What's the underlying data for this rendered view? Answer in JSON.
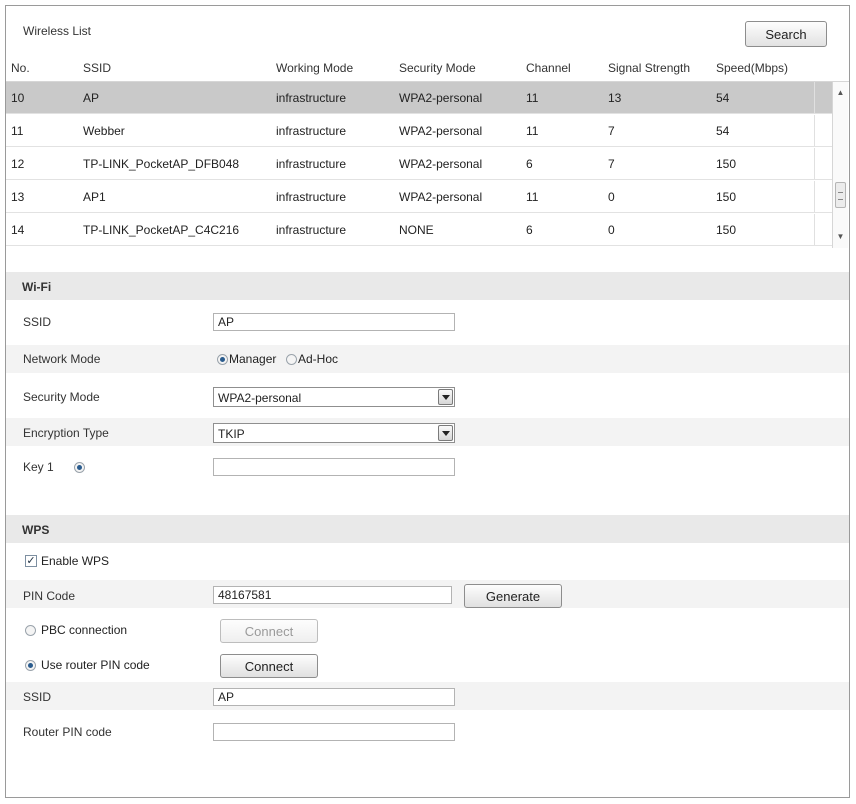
{
  "wireless_list": {
    "title": "Wireless List",
    "search_label": "Search",
    "columns": [
      "No.",
      "SSID",
      "Working Mode",
      "Security Mode",
      "Channel",
      "Signal Strength",
      "Speed(Mbps)"
    ],
    "rows": [
      [
        "10",
        "AP",
        "infrastructure",
        "WPA2-personal",
        "11",
        "13",
        "54"
      ],
      [
        "11",
        "Webber",
        "infrastructure",
        "WPA2-personal",
        "11",
        "7",
        "54"
      ],
      [
        "12",
        "TP-LINK_PocketAP_DFB048",
        "infrastructure",
        "WPA2-personal",
        "6",
        "7",
        "150"
      ],
      [
        "13",
        "AP1",
        "infrastructure",
        "WPA2-personal",
        "11",
        "0",
        "150"
      ],
      [
        "14",
        "TP-LINK_PocketAP_C4C216",
        "infrastructure",
        "NONE",
        "6",
        "0",
        "150"
      ]
    ],
    "selected_row": 0
  },
  "wifi": {
    "section_title": "Wi-Fi",
    "ssid_label": "SSID",
    "ssid_value": "AP",
    "network_mode_label": "Network Mode",
    "mode_manager": "Manager",
    "mode_adhoc": "Ad-Hoc",
    "security_mode_label": "Security Mode",
    "security_mode_value": "WPA2-personal",
    "encryption_label": "Encryption Type",
    "encryption_value": "TKIP",
    "key_label": "Key 1",
    "key_value": ""
  },
  "wps": {
    "section_title": "WPS",
    "enable_label": "Enable WPS",
    "pin_label": "PIN Code",
    "pin_value": "48167581",
    "generate_label": "Generate",
    "pbc_label": "PBC connection",
    "pbc_connect_label": "Connect",
    "router_pin_option_label": "Use router PIN code",
    "router_connect_label": "Connect",
    "ssid_label": "SSID",
    "ssid_value": "AP",
    "router_pin_label": "Router PIN code",
    "router_pin_value": ""
  },
  "colors": {
    "selected_row": "#c9c9c9",
    "section_bg": "#e9e9e9",
    "radio_dot": "#2a5c8e"
  }
}
